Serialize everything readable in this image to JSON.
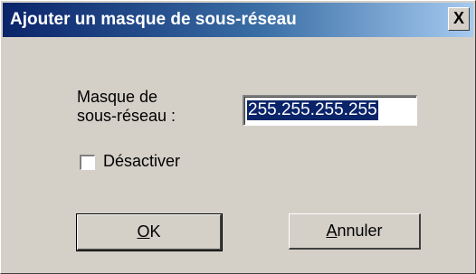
{
  "dialog": {
    "title": "Ajouter un masque de sous-réseau",
    "close_label": "X"
  },
  "form": {
    "mask_label_line1": "Masque de",
    "mask_label_line2": "sous-réseau :",
    "mask_value": "255.255.255.255",
    "disable_label": "Désactiver",
    "disable_checked": false
  },
  "buttons": {
    "ok_accel": "O",
    "ok_rest": "K",
    "cancel_accel": "A",
    "cancel_rest": "nnuler"
  }
}
